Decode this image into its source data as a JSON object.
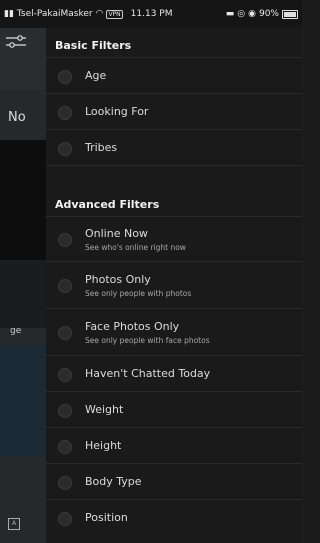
{
  "status": {
    "carrier": "Tsel-PakaiMasker",
    "vpn": "VPN",
    "time": "11.13 PM",
    "battery": "90%"
  },
  "background_app": {
    "no_label": "No",
    "age_label": "ge"
  },
  "basic_filters": {
    "title": "Basic Filters",
    "items": [
      {
        "label": "Age"
      },
      {
        "label": "Looking For"
      },
      {
        "label": "Tribes"
      }
    ]
  },
  "advanced_filters": {
    "title": "Advanced Filters",
    "items": [
      {
        "label": "Online Now",
        "subtitle": "See who's online right now"
      },
      {
        "label": "Photos Only",
        "subtitle": "See only people with photos"
      },
      {
        "label": "Face Photos Only",
        "subtitle": "See only people with face photos"
      },
      {
        "label": "Haven't Chatted Today"
      },
      {
        "label": "Weight"
      },
      {
        "label": "Height"
      },
      {
        "label": "Body Type"
      },
      {
        "label": "Position"
      }
    ]
  }
}
